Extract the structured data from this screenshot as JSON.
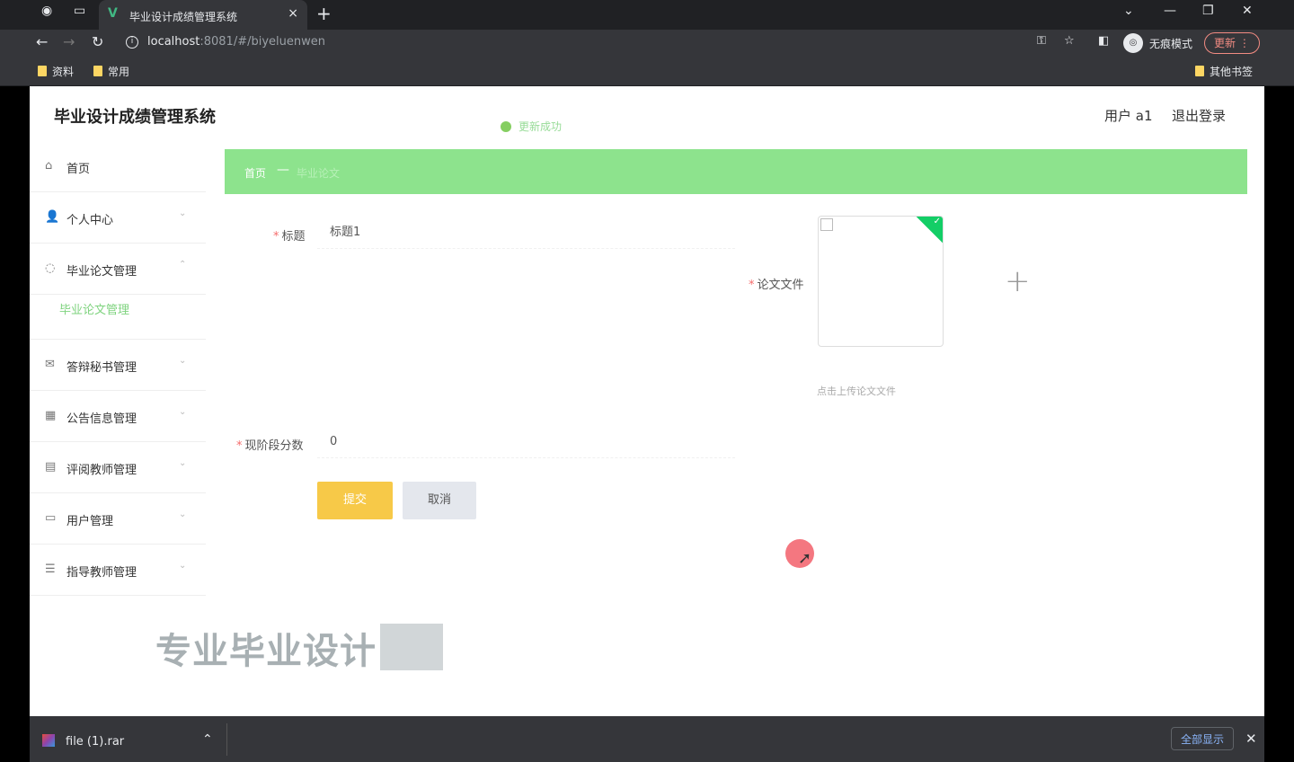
{
  "browser": {
    "tab_title": "毕业设计成绩管理系统",
    "tab_close": "×",
    "new_tab": "+",
    "url_host": "localhost",
    "url_path": ":8081/#/biyeluenwen",
    "incognito_label": "无痕模式",
    "update_label": "更新 ⋮",
    "bookmarks": [
      "资料",
      "常用"
    ],
    "other_bookmarks": "其他书签"
  },
  "app": {
    "title": "毕业设计成绩管理系统",
    "toast": "更新成功",
    "user_label": "用户 a1",
    "logout_label": "退出登录"
  },
  "sidebar": {
    "items": [
      {
        "label": "首页",
        "icon": "home-icon",
        "glyph": "⌂"
      },
      {
        "label": "个人中心",
        "icon": "user-icon",
        "glyph": "👤"
      },
      {
        "label": "毕业论文管理",
        "icon": "paper-icon",
        "glyph": "◌"
      },
      {
        "label": "答辩秘书管理",
        "icon": "mail-icon",
        "glyph": "✉"
      },
      {
        "label": "公告信息管理",
        "icon": "grid-icon",
        "glyph": "▦"
      },
      {
        "label": "评阅教师管理",
        "icon": "table-icon",
        "glyph": "▤"
      },
      {
        "label": "用户管理",
        "icon": "card-icon",
        "glyph": "▭"
      },
      {
        "label": "指导教师管理",
        "icon": "list-icon",
        "glyph": "☰"
      }
    ],
    "submenu_label": "毕业论文管理"
  },
  "breadcrumb": {
    "home": "首页",
    "separator": "—",
    "current": "毕业论文"
  },
  "form": {
    "title_label": "标题",
    "title_value": "标题1",
    "file_label": "论文文件",
    "upload_tip": "点击上传论文文件",
    "score_label": "现阶段分数",
    "score_value": "0",
    "save_label": "提交",
    "cancel_label": "取消"
  },
  "watermark": "专业毕业设计",
  "download": {
    "file_name": "file (1).rar",
    "show_all": "全部显示",
    "close": "✕"
  },
  "colors": {
    "accent_green": "#8de38d",
    "save_yellow": "#f7c948",
    "cancel_gray": "#e4e7ed"
  }
}
